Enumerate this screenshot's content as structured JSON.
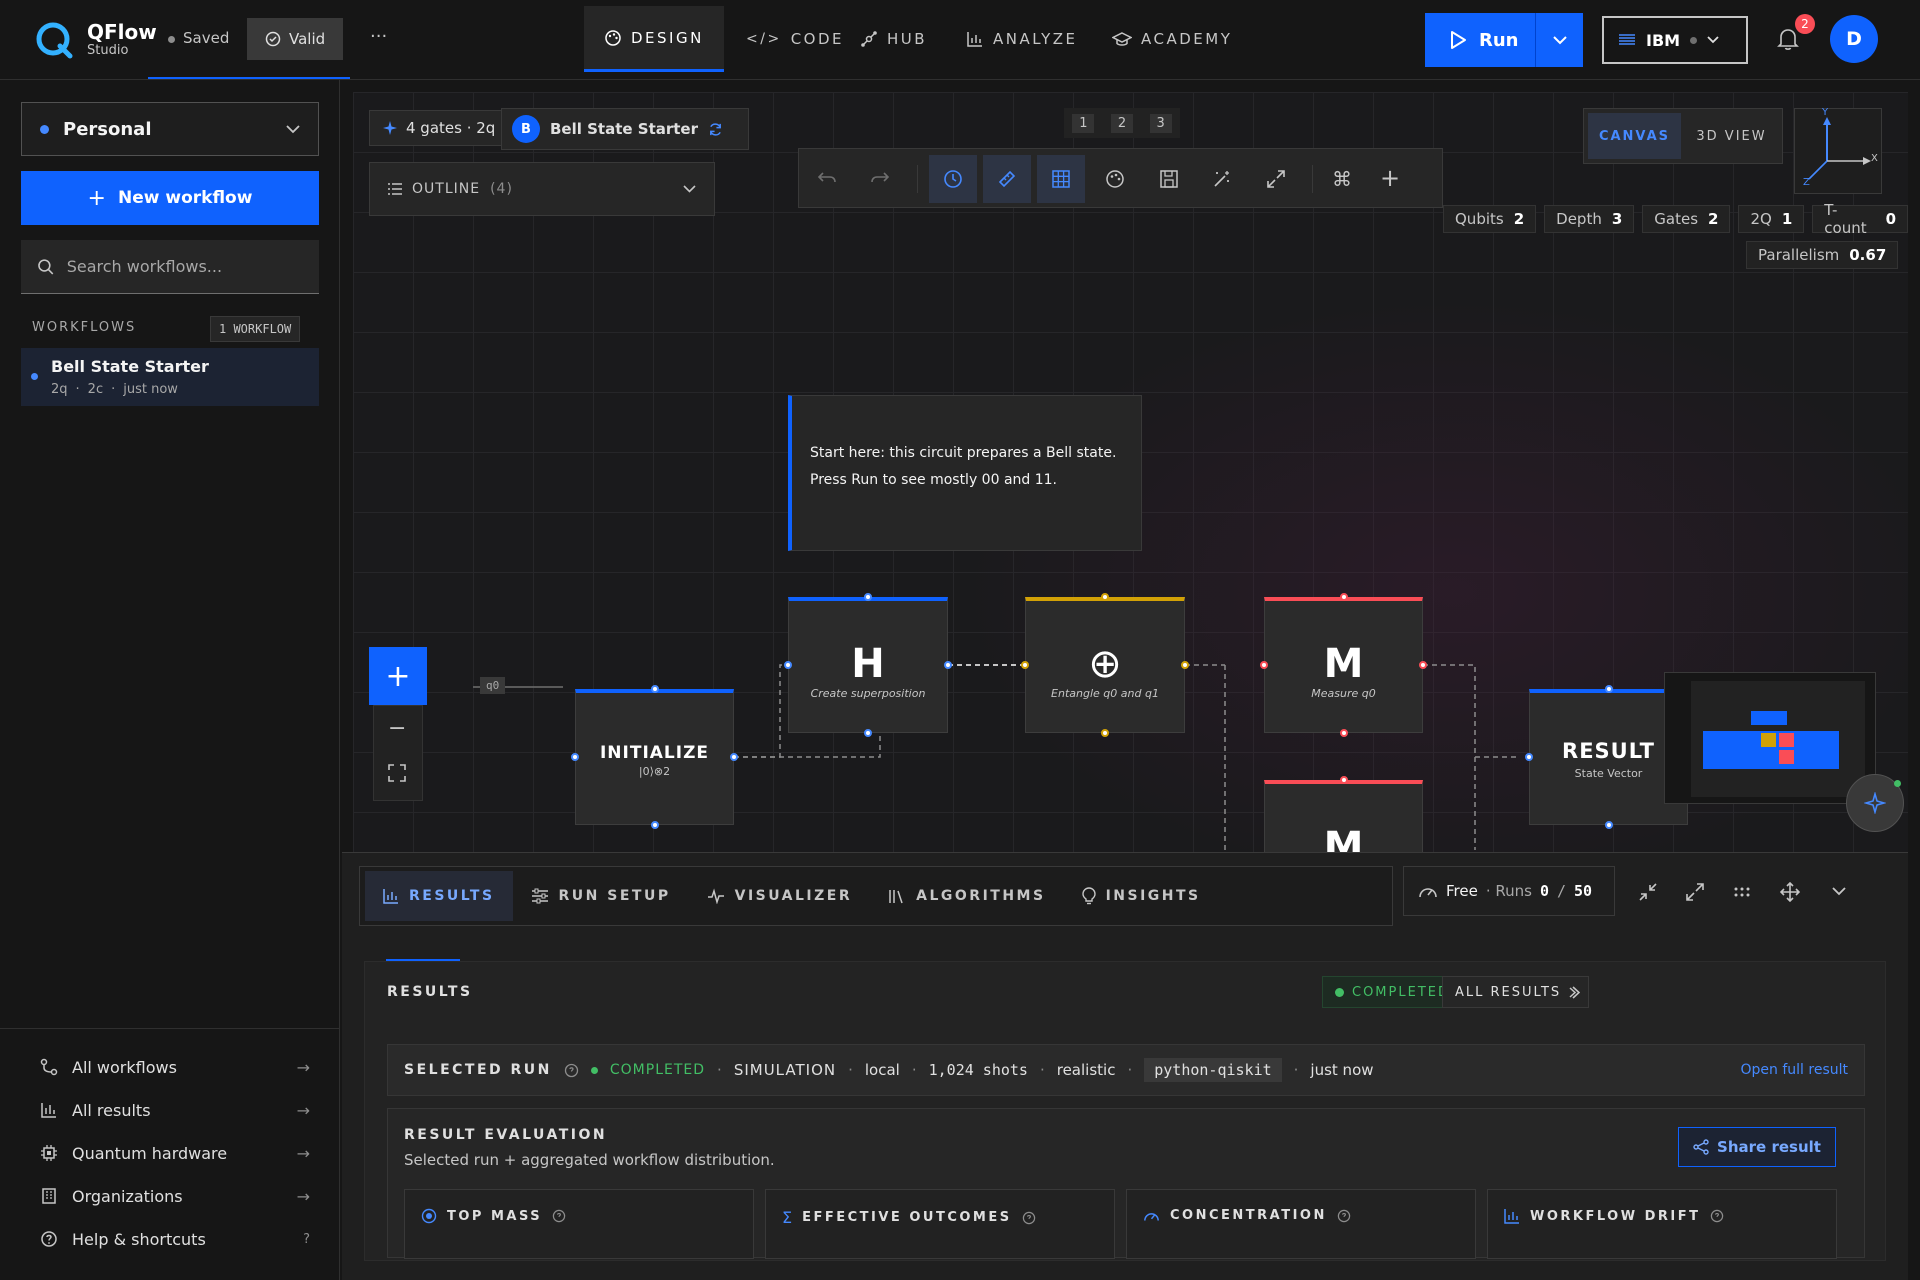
{
  "app": {
    "name": "QFlow",
    "sub": "Studio",
    "saved": "Saved",
    "valid": "Valid",
    "more": "···"
  },
  "nav": {
    "tabs": [
      {
        "label": "DESIGN",
        "icon": "palette-icon"
      },
      {
        "label": "CODE",
        "icon": "code-icon"
      },
      {
        "label": "HUB",
        "icon": "hub-icon"
      },
      {
        "label": "ANALYZE",
        "icon": "chart-icon"
      },
      {
        "label": "ACADEMY",
        "icon": "graduation-cap-icon"
      }
    ]
  },
  "run": {
    "label": "Run"
  },
  "backend": {
    "label": "IBM"
  },
  "notifications": {
    "count": "2"
  },
  "user": {
    "initial": "D"
  },
  "sidebar": {
    "workspace": "Personal",
    "new_workflow": "New workflow",
    "search_placeholder": "Search workflows...",
    "workflows_label": "WORKFLOWS",
    "workflows_count": "1 WORKFLOW",
    "workflow": {
      "name": "Bell State Starter",
      "qubits": "2q",
      "classical": "2c",
      "time": "just now"
    },
    "links": [
      {
        "label": "All workflows",
        "icon": "workflow-icon",
        "tail": "→"
      },
      {
        "label": "All results",
        "icon": "bar-chart-icon",
        "tail": "→"
      },
      {
        "label": "Quantum hardware",
        "icon": "chip-icon",
        "tail": "→"
      },
      {
        "label": "Organizations",
        "icon": "building-icon",
        "tail": "→"
      },
      {
        "label": "Help & shortcuts",
        "icon": "help-icon",
        "tail": "?"
      }
    ]
  },
  "canvas": {
    "gate_chip": "4 gates · 2q",
    "circuit_badge": "B",
    "circuit_name": "Bell State Starter",
    "outline": "OUTLINE",
    "outline_count": "(4)",
    "steps": [
      "1",
      "2",
      "3"
    ],
    "view_canvas": "CANVAS",
    "view_3d": "3D VIEW",
    "axis_x": "X",
    "axis_y": "Y",
    "axis_z": "Z",
    "metrics": [
      {
        "label": "Qubits",
        "value": "2"
      },
      {
        "label": "Depth",
        "value": "3"
      },
      {
        "label": "Gates",
        "value": "2"
      },
      {
        "label": "2Q",
        "value": "1"
      },
      {
        "label": "T-count",
        "value": "0"
      }
    ],
    "parallelism": {
      "label": "Parallelism",
      "value": "0.67"
    },
    "note": "Start here: this circuit prepares a Bell state. Press Run to see mostly 00 and 11.",
    "qubit_label": "q0",
    "nodes": {
      "init": {
        "title": "INITIALIZE",
        "sub": "|0⟩⊗2"
      },
      "h": {
        "sym": "H",
        "sub": "Create superposition"
      },
      "cx": {
        "sym": "⊕",
        "sub": "Entangle q0 and q1"
      },
      "m0": {
        "sym": "M",
        "sub": "Measure q0"
      },
      "m1": {
        "sym": "M"
      },
      "result": {
        "title": "RESULT",
        "sub": "State Vector"
      }
    },
    "colors": {
      "blue": "#0f62fe",
      "yellow": "#d2a106",
      "red": "#fa4d56"
    }
  },
  "panel": {
    "tabs": [
      {
        "label": "RESULTS",
        "icon": "bar-chart-icon"
      },
      {
        "label": "RUN SETUP",
        "icon": "sliders-icon"
      },
      {
        "label": "VISUALIZER",
        "icon": "pulse-icon"
      },
      {
        "label": "ALGORITHMS",
        "icon": "library-icon"
      },
      {
        "label": "INSIGHTS",
        "icon": "lightbulb-icon"
      }
    ],
    "plan": "Free",
    "runs_label": "· Runs",
    "runs_used": "0",
    "runs_sep": "/",
    "runs_total": "50",
    "results_title": "RESULTS",
    "status": "COMPLETED",
    "all_results": "ALL RESULTS",
    "selected_run": {
      "label": "SELECTED RUN",
      "status": "COMPLETED",
      "mode": "SIMULATION",
      "backend": "local",
      "shots": "1,024 shots",
      "noise": "realistic",
      "sdk": "python-qiskit",
      "time": "just now",
      "open": "Open full result"
    },
    "evaluation": {
      "title": "RESULT EVALUATION",
      "subtitle": "Selected run + aggregated workflow distribution.",
      "share": "Share result",
      "cards": [
        {
          "label": "TOP MASS",
          "icon": "target-icon"
        },
        {
          "label": "EFFECTIVE OUTCOMES",
          "icon": "sigma-icon"
        },
        {
          "label": "CONCENTRATION",
          "icon": "gauge-icon"
        },
        {
          "label": "WORKFLOW DRIFT",
          "icon": "bar-chart-icon"
        }
      ]
    }
  }
}
